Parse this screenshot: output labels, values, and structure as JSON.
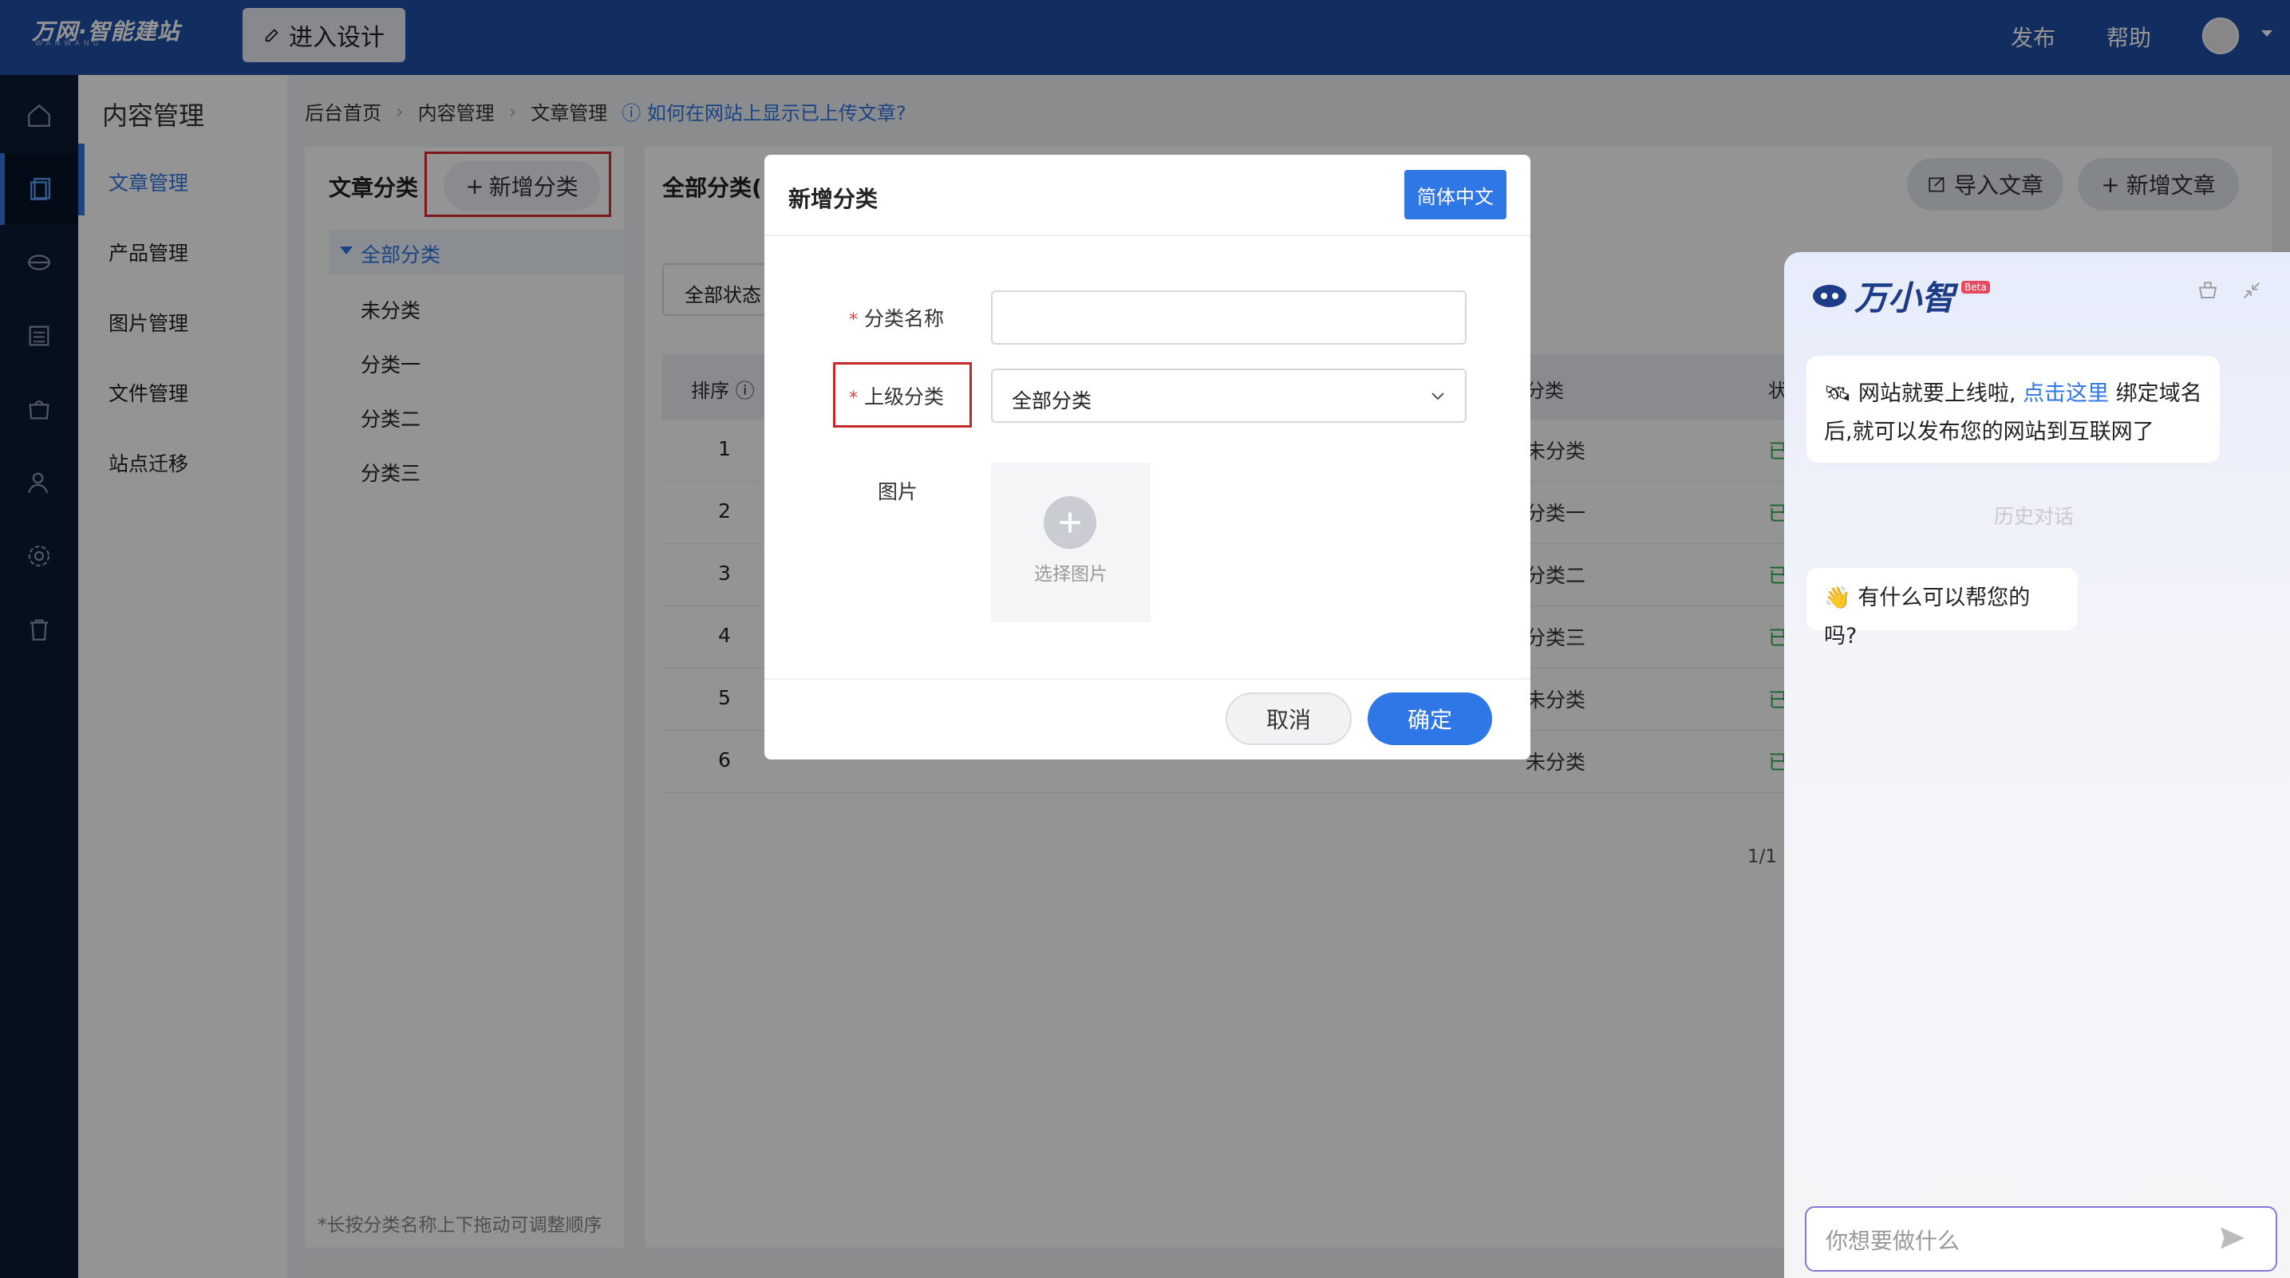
{
  "header": {
    "logo": "万网·智能建站",
    "logo_sub": "WANWANG",
    "design_button": "进入设计",
    "publish": "发布",
    "help": "帮助"
  },
  "rail": {
    "icons": [
      "home-icon",
      "article-icon",
      "product-icon",
      "list-icon",
      "shop-icon",
      "user-icon",
      "gear-icon",
      "trash-icon"
    ]
  },
  "submenu": {
    "title": "内容管理",
    "items": [
      {
        "label": "文章管理"
      },
      {
        "label": "产品管理"
      },
      {
        "label": "图片管理"
      },
      {
        "label": "文件管理"
      },
      {
        "label": "站点迁移"
      }
    ]
  },
  "breadcrumb": {
    "items": [
      "后台首页",
      "内容管理",
      "文章管理"
    ],
    "help_link": "如何在网站上显示已上传文章?"
  },
  "categories": {
    "title": "文章分类",
    "add_button": "新增分类",
    "all": "全部分类",
    "items": [
      "未分类",
      "分类一",
      "分类二",
      "分类三"
    ],
    "note": "*长按分类名称上下拖动可调整顺序"
  },
  "list": {
    "title": "全部分类(",
    "status_filter": "全部状态",
    "import_button": "导入文章",
    "new_button": "新增文章",
    "columns": {
      "order": "排序",
      "category": "分类",
      "status": "状"
    },
    "rows": [
      {
        "num": "1",
        "category": "未分类",
        "status": "已"
      },
      {
        "num": "2",
        "category": "分类一",
        "status": "已"
      },
      {
        "num": "3",
        "category": "分类二",
        "status": "已"
      },
      {
        "num": "4",
        "category": "分类三",
        "status": "已"
      },
      {
        "num": "5",
        "category": "未分类",
        "status": "已"
      },
      {
        "num": "6",
        "category": "未分类",
        "status": "已"
      }
    ],
    "pager": "1/1 页"
  },
  "dialog": {
    "title": "新增分类",
    "lang_button": "简体中文",
    "name_label": "分类名称",
    "parent_label": "上级分类",
    "parent_value": "全部分类",
    "image_label": "图片",
    "image_button": "选择图片",
    "cancel": "取消",
    "ok": "确定"
  },
  "assistant": {
    "brand": "万小智",
    "beta": "Beta",
    "msg1_prefix": "网站就要上线啦,",
    "msg1_link": "点击这里",
    "msg1_suffix": "绑定域名后,就可以发布您的网站到互联网了",
    "history": "历史对话",
    "msg2": "有什么可以帮您的吗?",
    "input_placeholder": "你想要做什么"
  },
  "colors": {
    "primary": "#2f76e6",
    "topbar": "#1f4fa6",
    "highlight": "#d9292b"
  }
}
